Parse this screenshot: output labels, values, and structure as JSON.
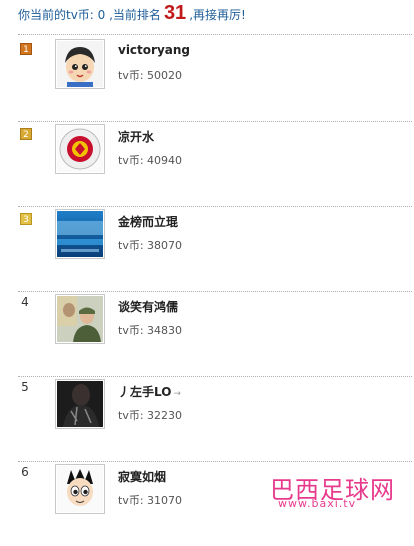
{
  "status": {
    "prefix": "你当前的tv币: 0 ,当前排名",
    "rank": "31",
    "suffix": ",再接再厉!"
  },
  "leaderboard": [
    {
      "rank": "1",
      "name": "victoryang",
      "score": "tv币: 50020",
      "avatar": "cartoon-boy-avatar"
    },
    {
      "rank": "2",
      "name": "凉开水",
      "score": "tv币: 40940",
      "avatar": "club-crest-avatar"
    },
    {
      "rank": "3",
      "name": "金榜而立琨",
      "score": "tv币: 38070",
      "avatar": "site-logo-avatar"
    },
    {
      "rank": "4",
      "name": "谈笑有鸿儒",
      "score": "tv币: 34830",
      "avatar": "portrait-photo-avatar"
    },
    {
      "rank": "5",
      "name": "丿左手LO",
      "score": "tv币: 32230",
      "avatar": "dark-photo-avatar"
    },
    {
      "rank": "6",
      "name": "寂寞如烟",
      "score": "tv币: 31070",
      "avatar": "astro-boy-avatar"
    }
  ],
  "watermark": {
    "text": "巴西足球网",
    "url": "www.baxi.tv"
  },
  "colors": {
    "status_text": "#1f5d99",
    "rank_highlight": "#c11a1a",
    "badge_gold": "#d1761d",
    "watermark": "#e83a8c"
  }
}
